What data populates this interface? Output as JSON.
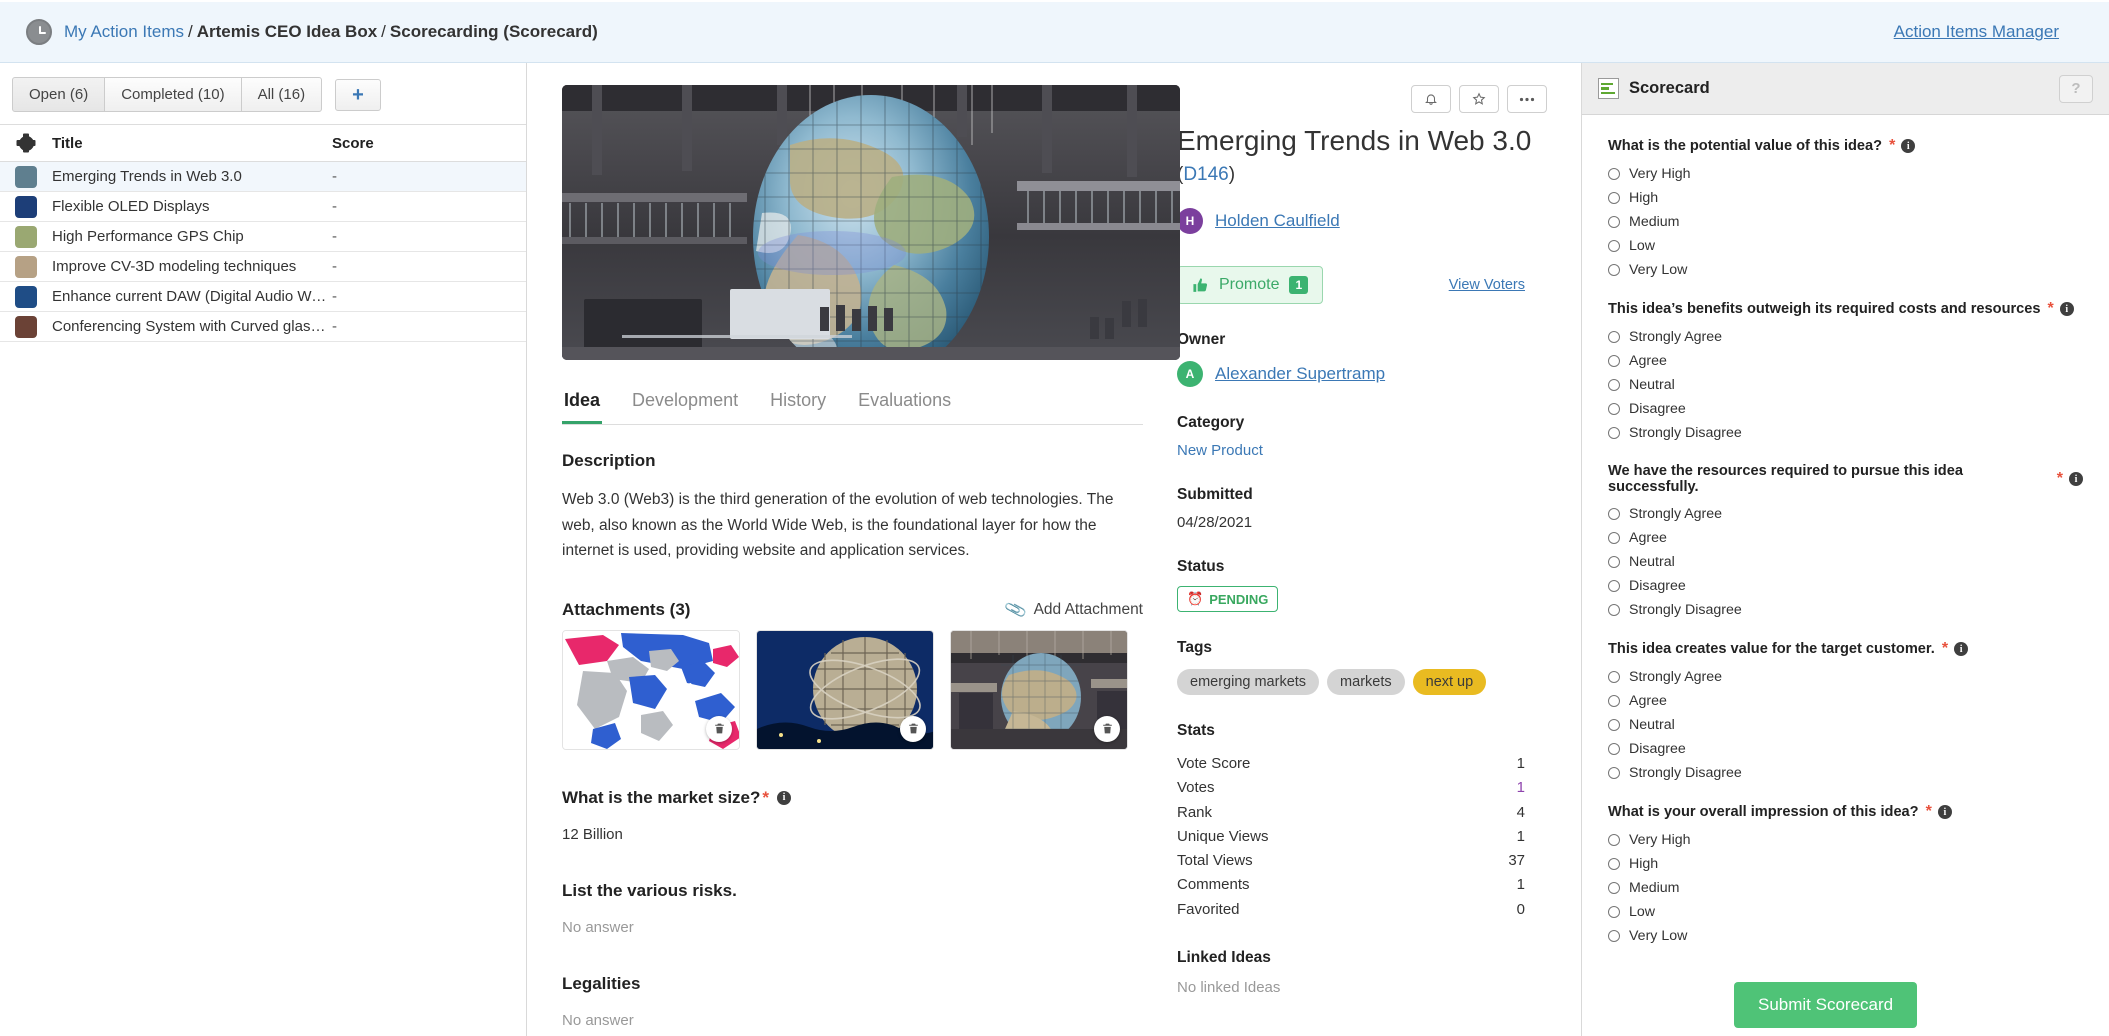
{
  "topbar": {
    "crumb_link": "My Action Items",
    "crumb_sep1": "/",
    "crumb_mid": "Artemis CEO Idea Box",
    "crumb_sep2": "/",
    "crumb_last": "Scorecarding (Scorecard)",
    "right_link": "Action Items Manager"
  },
  "left": {
    "tabs": [
      {
        "label": "Open (6)",
        "active": true
      },
      {
        "label": "Completed (10)",
        "active": false
      },
      {
        "label": "All (16)",
        "active": false
      }
    ],
    "add_label": "+",
    "columns": {
      "gear": "",
      "title": "Title",
      "score": "Score"
    },
    "rows": [
      {
        "title": "Emerging Trends in Web 3.0",
        "score": "-",
        "thumb": "#5f7f8f",
        "selected": true
      },
      {
        "title": "Flexible OLED Displays",
        "score": "-",
        "thumb": "#1d3e78",
        "selected": false
      },
      {
        "title": "High Performance GPS Chip",
        "score": "-",
        "thumb": "#9aa872",
        "selected": false
      },
      {
        "title": "Improve CV-3D modeling techniques",
        "score": "-",
        "thumb": "#b6a185",
        "selected": false
      },
      {
        "title": "Enhance current DAW (Digital Audio Workstati...",
        "score": "-",
        "thumb": "#1f4d86",
        "selected": false
      },
      {
        "title": "Conferencing System with Curved glass display",
        "score": "-",
        "thumb": "#6b4236",
        "selected": false
      }
    ]
  },
  "center": {
    "tabs": [
      {
        "label": "Idea",
        "active": true
      },
      {
        "label": "Development",
        "active": false
      },
      {
        "label": "History",
        "active": false
      },
      {
        "label": "Evaluations",
        "active": false
      }
    ],
    "description_heading": "Description",
    "description_text": "Web 3.0 (Web3) is the third generation of the evolution of web technologies. The web, also known as the World Wide Web, is the foundational layer for how the internet is used, providing website and application services.",
    "attachments_heading": "Attachments (3)",
    "add_attachment": "Add Attachment",
    "attachment_count": 3,
    "questions": [
      {
        "label": "What is the market size?",
        "required": true,
        "has_info": true,
        "answer": "12 Billion",
        "empty": false
      },
      {
        "label": "List the various risks.",
        "required": false,
        "has_info": false,
        "answer": "No answer",
        "empty": true
      },
      {
        "label": "Legalities",
        "required": false,
        "has_info": false,
        "answer": "No answer",
        "empty": true
      }
    ]
  },
  "detail": {
    "icons": {
      "bell": "bell-icon",
      "star": "star-icon",
      "more": "ellipsis-icon"
    },
    "title": "Emerging Trends in Web 3.0",
    "id_open": "(",
    "id": "D146",
    "id_close": ")",
    "submitter": {
      "initial": "H",
      "name": "Holden Caulfield",
      "color": "#7b3f9d"
    },
    "promote_label": "Promote",
    "promote_count": "1",
    "view_voters": "View Voters",
    "owner_label": "Owner",
    "owner": {
      "initial": "A",
      "name": "Alexander Supertramp",
      "color": "#3cb371"
    },
    "category_label": "Category",
    "category": "New Product",
    "submitted_label": "Submitted",
    "submitted": "04/28/2021",
    "status_label": "Status",
    "status": "PENDING",
    "tags_label": "Tags",
    "tags": [
      {
        "label": "emerging markets",
        "gold": false
      },
      {
        "label": "markets",
        "gold": false
      },
      {
        "label": "next up",
        "gold": true
      }
    ],
    "stats_label": "Stats",
    "stats": [
      {
        "label": "Vote Score",
        "value": "1",
        "link": false
      },
      {
        "label": "Votes",
        "value": "1",
        "link": true
      },
      {
        "label": "Rank",
        "value": "4",
        "link": false
      },
      {
        "label": "Unique Views",
        "value": "1",
        "link": false
      },
      {
        "label": "Total Views",
        "value": "37",
        "link": false
      },
      {
        "label": "Comments",
        "value": "1",
        "link": false
      },
      {
        "label": "Favorited",
        "value": "0",
        "link": false
      }
    ],
    "linked_label": "Linked Ideas",
    "linked_empty": "No linked Ideas"
  },
  "scorecard": {
    "panel_title": "Scorecard",
    "help_label": "?",
    "submit_label": "Submit Scorecard",
    "submit_color": "#4fc377",
    "questions": [
      {
        "label": "What is the potential value of this idea?",
        "required": true,
        "options": [
          "Very High",
          "High",
          "Medium",
          "Low",
          "Very Low"
        ]
      },
      {
        "label": "This idea’s benefits outweigh its required costs and resources",
        "required": true,
        "options": [
          "Strongly Agree",
          "Agree",
          "Neutral",
          "Disagree",
          "Strongly Disagree"
        ]
      },
      {
        "label": "We have the resources required to pursue this idea successfully.",
        "required": true,
        "options": [
          "Strongly Agree",
          "Agree",
          "Neutral",
          "Disagree",
          "Strongly Disagree"
        ]
      },
      {
        "label": "This idea creates value for the target customer.",
        "required": true,
        "options": [
          "Strongly Agree",
          "Agree",
          "Neutral",
          "Disagree",
          "Strongly Disagree"
        ]
      },
      {
        "label": "What is your overall impression of this idea?",
        "required": true,
        "options": [
          "Very High",
          "High",
          "Medium",
          "Low",
          "Very Low"
        ]
      }
    ]
  }
}
